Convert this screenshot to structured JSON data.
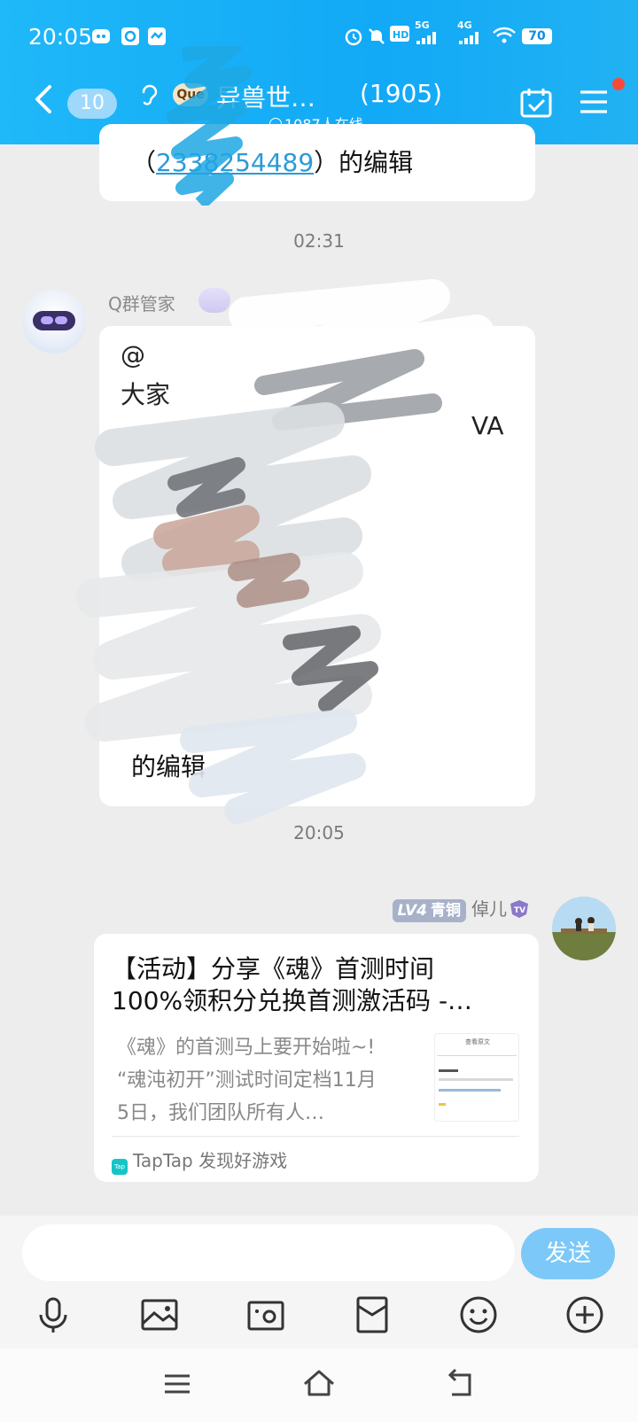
{
  "status_bar": {
    "time": "20:05",
    "network_1": "5G",
    "network_2": "4G",
    "hd_label": "HD",
    "battery": "70"
  },
  "header": {
    "unread_count": "10",
    "group_logo_text": "Que",
    "group_name": "异兽世…",
    "member_count": "(1905)",
    "online_text": "1087人在线"
  },
  "messages": {
    "prev_bubble": {
      "open_paren": "（",
      "qq_number": "2338254489",
      "tail": "）的编辑"
    },
    "timestamp_1": "02:31",
    "bot": {
      "sender": "Q群管家",
      "line_1": "@",
      "line_2": "大家",
      "line_3": "VA",
      "tail": "的编辑"
    },
    "timestamp_2": "20:05",
    "me": {
      "level": "LV4",
      "rank": "青铜",
      "nickname": "倬儿",
      "share_card": {
        "title_line_1": "【活动】分享《魂》首测时间",
        "title_line_2": "100%领积分兑换首测激活码 -…",
        "desc_line_1": "《魂》的首测马上要开始啦~!",
        "desc_line_2": "“魂沌初开”测试时间定档11月",
        "desc_line_3": "5日，我们团队所有人…",
        "thumb_header": "查看原文",
        "source_icon": "Tap",
        "source": "TapTap 发现好游戏"
      }
    }
  },
  "input_bar": {
    "placeholder": "",
    "send_label": "发送"
  },
  "colors": {
    "header_blue": "#12a9f6",
    "send_button": "#7cc8f8",
    "link_blue": "#2b9bd6",
    "notification_red": "#f74a3c"
  }
}
